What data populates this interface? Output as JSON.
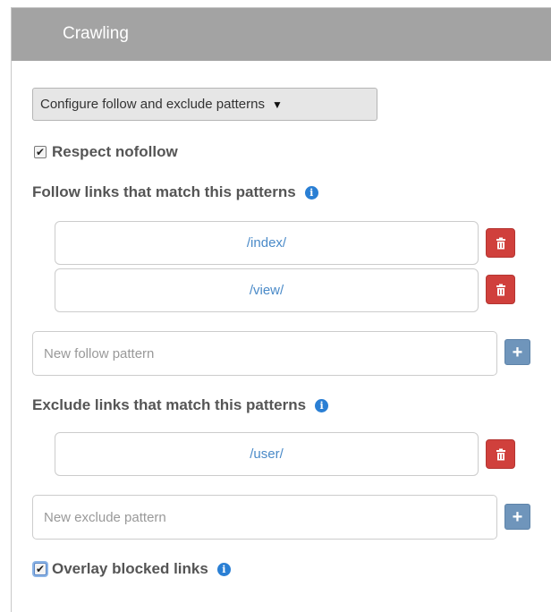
{
  "header": {
    "title": "Crawling"
  },
  "dropdown": {
    "selected": "Configure follow and exclude patterns",
    "caret": "▼"
  },
  "respect_nofollow": {
    "label": "Respect nofollow",
    "checked": true
  },
  "follow": {
    "heading": "Follow links that match this patterns",
    "patterns": [
      "/index/",
      "/view/"
    ],
    "placeholder": "New follow pattern"
  },
  "exclude": {
    "heading": "Exclude links that match this patterns",
    "patterns": [
      "/user/"
    ],
    "placeholder": "New exclude pattern"
  },
  "overlay_blocked": {
    "label": "Overlay blocked links",
    "checked": true
  },
  "icons": {
    "info": "info-icon",
    "delete": "trash-icon",
    "add": "plus-icon",
    "check": "checkmark-icon"
  },
  "colors": {
    "header_bg": "#a3a3a3",
    "info": "#2a7fd4",
    "delete": "#d0403c",
    "add": "#6f95bb",
    "pattern_text": "#4a8ac8"
  }
}
